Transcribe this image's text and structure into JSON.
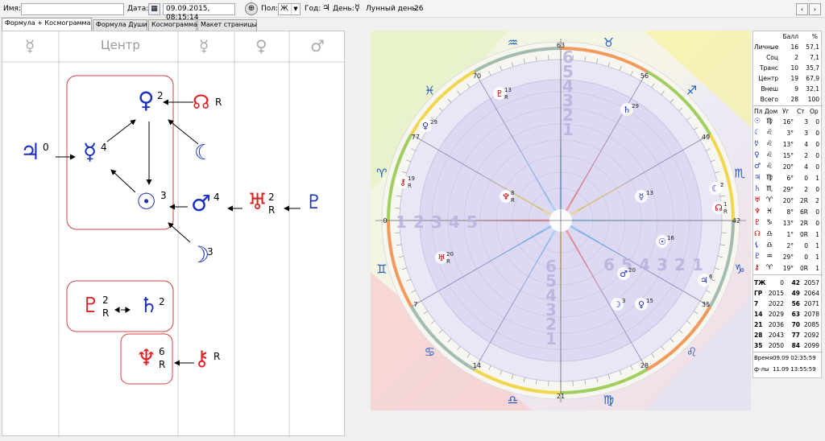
{
  "toolbar": {
    "name_label": "Имя:",
    "name_value": "",
    "date_label": "Дата:",
    "date_value": "09.09.2015, 08:15:14",
    "gender_label": "Пол:",
    "gender_value": "Ж",
    "year_label": "Год:",
    "year_glyph": "♃",
    "day_label": "День:",
    "day_glyph": "☿",
    "lunar_label": "Лунный день:",
    "lunar_value": "26",
    "nav_prev": "‹",
    "nav_next": "›"
  },
  "tabs": [
    {
      "label": "Формула + Космограмма",
      "active": true
    },
    {
      "label": "Формула Души",
      "active": false
    },
    {
      "label": "Космограмма",
      "active": false
    },
    {
      "label": "Макет страницы",
      "active": false
    }
  ],
  "formula": {
    "headers": [
      "☿",
      "Центр",
      "☿",
      "♀",
      "♂"
    ],
    "nodes": [
      {
        "glyph": "♃",
        "num": "0",
        "r": "",
        "color": "#1a2fc0"
      },
      {
        "glyph": "☿",
        "num": "4",
        "r": "",
        "color": "#1a2fc0"
      },
      {
        "glyph": "♀",
        "num": "2",
        "r": "",
        "color": "#1a2fc0"
      },
      {
        "glyph": "☊",
        "num": "",
        "r": "R",
        "color": "#e02020"
      },
      {
        "glyph": "☾",
        "num": "",
        "r": "",
        "color": "#1a2fc0"
      },
      {
        "glyph": "☉",
        "num": "3",
        "r": "",
        "color": "#1a2fc0"
      },
      {
        "glyph": "♂",
        "num": "4",
        "r": "",
        "color": "#1a2fc0"
      },
      {
        "glyph": "♅",
        "num": "2",
        "r": "R",
        "color": "#e02020"
      },
      {
        "glyph": "♇",
        "num": "",
        "r": "",
        "color": "#1a2fc0"
      },
      {
        "glyph": "☽",
        "num": "3",
        "r": "",
        "color": "#1a2fc0"
      },
      {
        "glyph": "♇",
        "num": "2",
        "r": "R",
        "color": "#e02020"
      },
      {
        "glyph": "♄",
        "num": "2",
        "r": "",
        "color": "#1a2fc0"
      },
      {
        "glyph": "♆",
        "num": "6",
        "r": "R",
        "color": "#e02020"
      },
      {
        "glyph": "⚷",
        "num": "",
        "r": "R",
        "color": "#e02020"
      }
    ]
  },
  "chart": {
    "degree_labels": [
      "63",
      "56",
      "49",
      "42",
      "35",
      "28",
      "21",
      "14",
      "7",
      "0",
      "77",
      "70"
    ],
    "signs": [
      "♉",
      "♐",
      "♏",
      "♑",
      "♌",
      "♍",
      "♎",
      "♋",
      "♊",
      "♈",
      "♓",
      "♒"
    ],
    "planets": [
      {
        "glyph": "♇",
        "deg": "13",
        "r": "R",
        "color": "#c00000"
      },
      {
        "glyph": "♄",
        "deg": "29",
        "r": "",
        "color": "#1a2fc0"
      },
      {
        "glyph": "♀",
        "deg": "29",
        "r": "",
        "color": "#1a2fc0"
      },
      {
        "glyph": "⚷",
        "deg": "19",
        "r": "R",
        "color": "#c00000"
      },
      {
        "glyph": "♆",
        "deg": "8",
        "r": "R",
        "color": "#c00000"
      },
      {
        "glyph": "☿",
        "deg": "13",
        "r": "",
        "color": "#1a2fc0"
      },
      {
        "glyph": "☾",
        "deg": "2",
        "r": "",
        "color": "#1a2fc0"
      },
      {
        "glyph": "☊",
        "deg": "1",
        "r": "R",
        "color": "#c00000"
      },
      {
        "glyph": "♅",
        "deg": "20",
        "r": "R",
        "color": "#c00000"
      },
      {
        "glyph": "☉",
        "deg": "16",
        "r": "",
        "color": "#1a2fc0"
      },
      {
        "glyph": "♂",
        "deg": "20",
        "r": "",
        "color": "#1a2fc0"
      },
      {
        "glyph": "♃",
        "deg": "6",
        "r": "",
        "color": "#1a2fc0"
      },
      {
        "glyph": "☽",
        "deg": "3",
        "r": "",
        "color": "#1a2fc0"
      },
      {
        "glyph": "♀",
        "deg": "15",
        "r": "",
        "color": "#1a2fc0"
      }
    ],
    "house_numbers_left": [
      "1",
      "2",
      "3",
      "4",
      "5"
    ],
    "house_numbers_top": [
      "1",
      "2",
      "3",
      "4",
      "5",
      "6"
    ],
    "house_numbers_right": [
      "6",
      "5",
      "4",
      "3",
      "2",
      "1"
    ],
    "house_numbers_bottom": [
      "6",
      "5",
      "4",
      "3",
      "2",
      "1"
    ]
  },
  "scores": {
    "headers": [
      "Балл",
      "%"
    ],
    "rows": [
      {
        "label": "Личные",
        "ball": "16",
        "pct": "57,1"
      },
      {
        "label": "Соц",
        "ball": "2",
        "pct": "7,1"
      },
      {
        "label": "Транс",
        "ball": "10",
        "pct": "35,7"
      },
      {
        "label": "Центр",
        "ball": "19",
        "pct": "67,9"
      },
      {
        "label": "Внеш",
        "ball": "9",
        "pct": "32,1"
      },
      {
        "label": "Всего",
        "ball": "28",
        "pct": "100"
      }
    ]
  },
  "planet_table": {
    "headers": [
      "Пл",
      "Дом",
      "Уг",
      "Ст",
      "Ор"
    ],
    "rows": [
      {
        "pl": "☉",
        "dom": "♍",
        "ug": "16°",
        "st": "3",
        "or": "0",
        "color": "#1a2fc0"
      },
      {
        "pl": "☾",
        "dom": "♌",
        "ug": "3°",
        "st": "3",
        "or": "0",
        "color": "#1a2fc0"
      },
      {
        "pl": "☿",
        "dom": "♌",
        "ug": "13°",
        "st": "4",
        "or": "0",
        "color": "#1a2fc0"
      },
      {
        "pl": "♀",
        "dom": "♌",
        "ug": "15°",
        "st": "2",
        "or": "0",
        "color": "#1a2fc0"
      },
      {
        "pl": "♂",
        "dom": "♌",
        "ug": "20°",
        "st": "4",
        "or": "0",
        "color": "#1a2fc0"
      },
      {
        "pl": "♃",
        "dom": "♍",
        "ug": "6°",
        "st": "0",
        "or": "1",
        "color": "#1a2fc0"
      },
      {
        "pl": "♄",
        "dom": "♏",
        "ug": "29°",
        "st": "2",
        "or": "0",
        "color": "#1a2fc0"
      },
      {
        "pl": "♅",
        "dom": "♈",
        "ug": "20°",
        "st": "2R",
        "or": "2",
        "color": "#c00000"
      },
      {
        "pl": "♆",
        "dom": "♓",
        "ug": "8°",
        "st": "6R",
        "or": "0",
        "color": "#c00000"
      },
      {
        "pl": "♇",
        "dom": "♑",
        "ug": "13°",
        "st": "2R",
        "or": "0",
        "color": "#c00000"
      },
      {
        "pl": "☊",
        "dom": "♎",
        "ug": "1°",
        "st": "0R",
        "or": "1",
        "color": "#c00000"
      },
      {
        "pl": "⚸",
        "dom": "♎",
        "ug": "2°",
        "st": "0",
        "or": "1",
        "color": "#1a2fc0"
      },
      {
        "pl": "♇",
        "dom": "♒",
        "ug": "29°",
        "st": "0",
        "or": "1",
        "color": "#1a2fc0"
      },
      {
        "pl": "⚷",
        "dom": "♈",
        "ug": "19°",
        "st": "0R",
        "or": "1",
        "color": "#c00000"
      }
    ]
  },
  "years_table": {
    "rows": [
      [
        "ТЖ",
        "0",
        "42",
        "2057"
      ],
      [
        "ГР",
        "2015",
        "49",
        "2064"
      ],
      [
        "7",
        "2022",
        "56",
        "2071"
      ],
      [
        "14",
        "2029",
        "63",
        "2078"
      ],
      [
        "21",
        "2036",
        "70",
        "2085"
      ],
      [
        "28",
        "2043",
        "77",
        "2092"
      ],
      [
        "35",
        "2050",
        "84",
        "2099"
      ]
    ]
  },
  "footer": {
    "time_label": "Время",
    "time_value": "09.09 02:35:59",
    "fly_label": "ф-лы",
    "fly_value": "11.09 13:55:59"
  }
}
